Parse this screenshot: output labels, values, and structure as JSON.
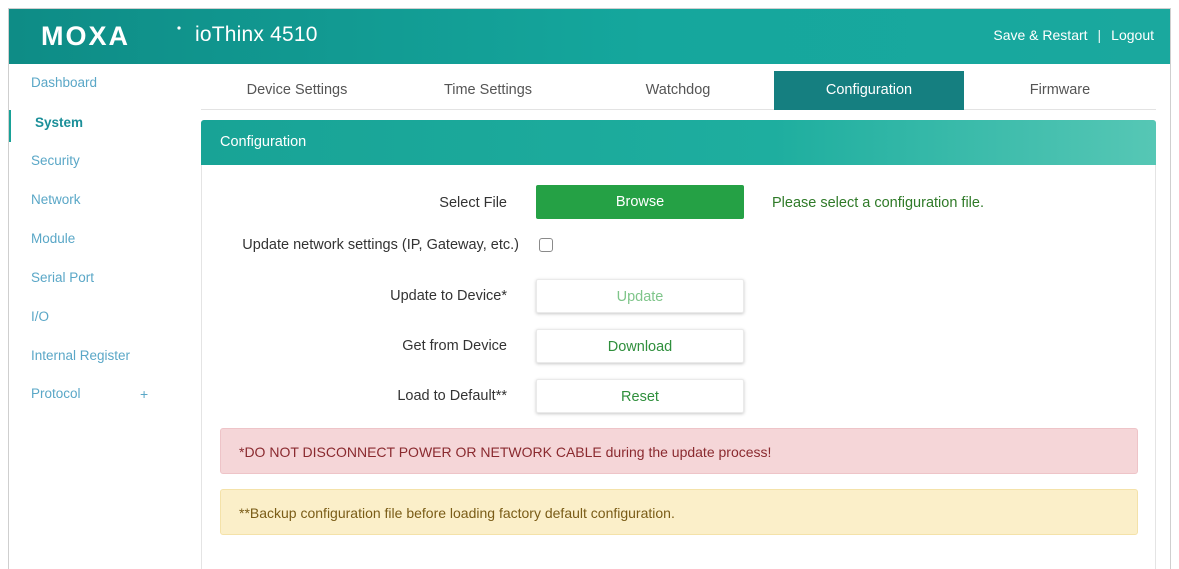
{
  "header": {
    "brand": "MOXA",
    "product": "ioThinx 4510",
    "actions": {
      "save_restart": "Save & Restart",
      "separator": "|",
      "logout": "Logout"
    }
  },
  "sidebar": {
    "items": [
      {
        "label": "Dashboard"
      },
      {
        "label": "System"
      },
      {
        "label": "Security"
      },
      {
        "label": "Network"
      },
      {
        "label": "Module"
      },
      {
        "label": "Serial Port"
      },
      {
        "label": "I/O"
      },
      {
        "label": "Internal Register"
      },
      {
        "label": "Protocol"
      }
    ],
    "protocol_expand": "+"
  },
  "tabs": [
    {
      "label": "Device Settings"
    },
    {
      "label": "Time Settings"
    },
    {
      "label": "Watchdog"
    },
    {
      "label": "Configuration"
    },
    {
      "label": "Firmware"
    }
  ],
  "panel": {
    "title": "Configuration",
    "select_file_label": "Select File",
    "browse_label": "Browse",
    "file_hint": "Please select a configuration file.",
    "update_network_label": "Update network settings (IP, Gateway, etc.)",
    "update_to_device_label": "Update to Device*",
    "update_button": "Update",
    "get_from_device_label": "Get from Device",
    "download_button": "Download",
    "load_default_label": "Load to Default**",
    "reset_button": "Reset",
    "alert_danger": "*DO NOT DISCONNECT POWER OR NETWORK CABLE during the update process!",
    "alert_warning": "**Backup configuration file before loading factory default configuration."
  },
  "colors": {
    "header": "#15a79d",
    "active_tab": "#157f80",
    "browse": "#25a145",
    "sidebar_link": "#5aa7c7"
  }
}
